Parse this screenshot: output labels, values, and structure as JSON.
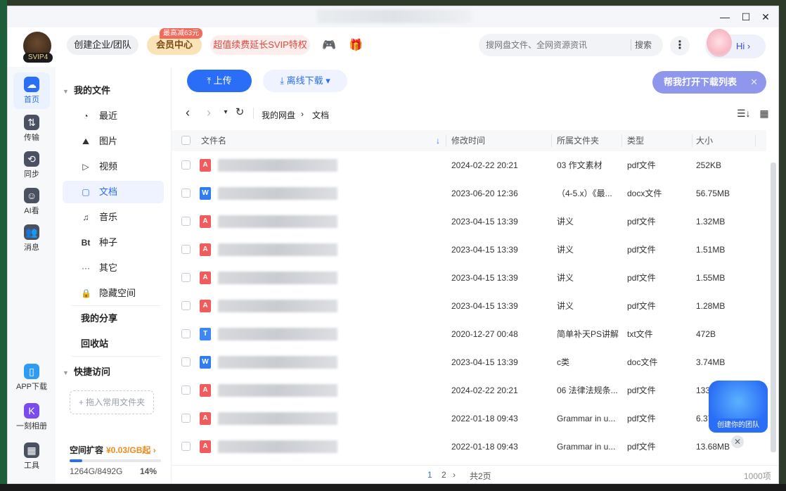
{
  "window": {
    "controls": [
      "—",
      "☐",
      "✕"
    ]
  },
  "header": {
    "user_badge": "SVIP4",
    "enterprise_label": "创建企业/团队",
    "member_label": "会员中心",
    "promo_badge": "最高减63元",
    "svip_label": "超值续费延长SVIP特权",
    "search_placeholder": "搜网盘文件、全网资源资讯",
    "search_button": "搜索",
    "more_label": "⋮",
    "hi_label": "Hi ›"
  },
  "rail": {
    "items": [
      {
        "label": "首页",
        "icon": "home-cloud-icon",
        "glyph": "☁",
        "color": "#2a6df6",
        "active": true
      },
      {
        "label": "传输",
        "icon": "transfer-icon",
        "glyph": "⇅",
        "color": "#4a5262",
        "active": false
      },
      {
        "label": "同步",
        "icon": "sync-icon",
        "glyph": "⟲",
        "color": "#4a5262",
        "active": false
      },
      {
        "label": "AI看",
        "icon": "ai-view-icon",
        "glyph": "☺",
        "color": "#4a5262",
        "active": false
      },
      {
        "label": "消息",
        "icon": "message-icon",
        "glyph": "👥",
        "color": "#4a5262",
        "active": false
      }
    ],
    "bottom_items": [
      {
        "label": "APP下载",
        "icon": "phone-icon",
        "glyph": "▯",
        "color": "#2f9cf3"
      },
      {
        "label": "一刻相册",
        "icon": "photo-album-icon",
        "glyph": "K",
        "color": "#7a4cf0"
      },
      {
        "label": "工具",
        "icon": "tools-icon",
        "glyph": "▦",
        "color": "#4a5262"
      }
    ]
  },
  "nav": {
    "my_files": "我的文件",
    "items": [
      {
        "label": "最近",
        "glyph": "◔",
        "icon": "clock-icon"
      },
      {
        "label": "图片",
        "glyph": "⛰",
        "icon": "picture-icon"
      },
      {
        "label": "视频",
        "glyph": "▷",
        "icon": "video-icon"
      },
      {
        "label": "文档",
        "glyph": "▢",
        "icon": "document-icon",
        "active": true
      },
      {
        "label": "音乐",
        "glyph": "♫",
        "icon": "music-icon"
      },
      {
        "label": "种子",
        "glyph": "Bt",
        "icon": "torrent-icon"
      },
      {
        "label": "其它",
        "glyph": "···",
        "icon": "other-icon"
      },
      {
        "label": "隐藏空间",
        "glyph": "🔒",
        "icon": "lock-icon"
      }
    ],
    "my_share": "我的分享",
    "recycle_bin": "回收站",
    "quick_access": "快捷访问",
    "drop_hint": "+ 拖入常用文件夹",
    "quota_title": "空间扩容",
    "quota_price": "¥0.03/GB起 ›",
    "quota_used": "1264G/8492G",
    "quota_percent": "14%",
    "quota_fraction": 0.14
  },
  "toolbar": {
    "upload": "⤒ 上传",
    "offline": "⤓ 离线下载 ▾",
    "help": "帮我打开下载列表",
    "help_close": "✕"
  },
  "path": {
    "back": "‹",
    "forward": "›",
    "dropdown": "▾",
    "refresh": "↻",
    "root": "我的网盘",
    "sep": "›",
    "current": "文档",
    "sort_icon": "☰↓",
    "grid_icon": "▦"
  },
  "table": {
    "columns": {
      "name": "文件名",
      "sort_arrow": "↓",
      "time": "修改时间",
      "folder": "所属文件夹",
      "type": "类型",
      "size": "大小"
    },
    "rows": [
      {
        "icon": "pdf",
        "time": "2024-02-22 20:21",
        "folder": "03 作文素材",
        "type": "pdf文件",
        "size": "252KB"
      },
      {
        "icon": "docx",
        "time": "2023-06-20 12:36",
        "folder": "（4-5.x）《最...",
        "type": "docx文件",
        "size": "56.75MB"
      },
      {
        "icon": "pdf",
        "time": "2023-04-15 13:39",
        "folder": "讲义",
        "type": "pdf文件",
        "size": "1.32MB"
      },
      {
        "icon": "pdf",
        "time": "2023-04-15 13:39",
        "folder": "讲义",
        "type": "pdf文件",
        "size": "1.51MB"
      },
      {
        "icon": "pdf",
        "time": "2023-04-15 13:39",
        "folder": "讲义",
        "type": "pdf文件",
        "size": "1.55MB"
      },
      {
        "icon": "pdf",
        "time": "2023-04-15 13:39",
        "folder": "讲义",
        "type": "pdf文件",
        "size": "1.28MB"
      },
      {
        "icon": "txt",
        "time": "2020-12-27 00:48",
        "folder": "简单补天PS讲解",
        "type": "txt文件",
        "size": "472B"
      },
      {
        "icon": "doc",
        "time": "2023-04-15 13:39",
        "folder": "c类",
        "type": "doc文件",
        "size": "3.74MB"
      },
      {
        "icon": "pdf",
        "time": "2024-02-22 20:21",
        "folder": "06 法律法规条...",
        "type": "pdf文件",
        "size": "133KB"
      },
      {
        "icon": "pdf",
        "time": "2022-01-18 09:43",
        "folder": "Grammar in u...",
        "type": "pdf文件",
        "size": "6.37MB"
      },
      {
        "icon": "pdf",
        "time": "2022-01-18 09:43",
        "folder": "Grammar in u...",
        "type": "pdf文件",
        "size": "13.68MB"
      }
    ]
  },
  "team_widget": {
    "label": "创建你的团队",
    "close": "✕"
  },
  "footer": {
    "page1": "1",
    "page2": "2",
    "next": "›",
    "total_pages": "共2页",
    "total_items": "1000项"
  },
  "colors": {
    "accent": "#2a6df6",
    "pdf": "#f15b5b",
    "doc": "#2f7cf6",
    "txt": "#3d86f5"
  }
}
